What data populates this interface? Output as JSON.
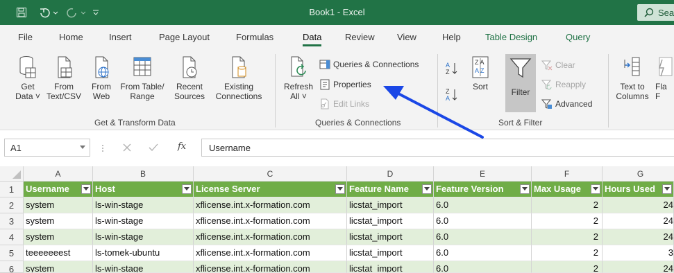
{
  "window": {
    "title": "Book1 - Excel",
    "search": "Sea"
  },
  "tabs": [
    {
      "label": "File"
    },
    {
      "label": "Home"
    },
    {
      "label": "Insert"
    },
    {
      "label": "Page Layout"
    },
    {
      "label": "Formulas"
    },
    {
      "label": "Data"
    },
    {
      "label": "Review"
    },
    {
      "label": "View"
    },
    {
      "label": "Help"
    },
    {
      "label": "Table Design"
    },
    {
      "label": "Query"
    }
  ],
  "ribbon": {
    "get_data": {
      "line1": "Get",
      "line2": "Data ˅"
    },
    "from_text": {
      "line1": "From",
      "line2": "Text/CSV"
    },
    "from_web": {
      "line1": "From",
      "line2": "Web"
    },
    "from_table": {
      "line1": "From Table/",
      "line2": "Range"
    },
    "recent": {
      "line1": "Recent",
      "line2": "Sources"
    },
    "existing": {
      "line1": "Existing",
      "line2": "Connections"
    },
    "group_get": "Get & Transform Data",
    "refresh": {
      "line1": "Refresh",
      "line2": "All ˅"
    },
    "queries_connections": "Queries & Connections",
    "properties": "Properties",
    "edit_links": "Edit Links",
    "group_queries": "Queries & Connections",
    "sort": "Sort",
    "filter": "Filter",
    "clear": "Clear",
    "reapply": "Reapply",
    "advanced": "Advanced",
    "group_sort": "Sort & Filter",
    "text_to_columns": {
      "line1": "Text to",
      "line2": "Columns"
    },
    "flash": {
      "line1": "Fla",
      "line2": "F"
    }
  },
  "formula_bar": {
    "name_box": "A1",
    "fx": "fx",
    "value": "Username"
  },
  "sheet": {
    "columns": [
      "A",
      "B",
      "C",
      "D",
      "E",
      "F",
      "G"
    ],
    "headers": [
      "Username",
      "Host",
      "License Server",
      "Feature Name",
      "Feature Version",
      "Max Usage",
      "Hours Used"
    ],
    "rows": [
      {
        "n": "2",
        "cells": [
          "system",
          "ls-win-stage",
          "xflicense.int.x-formation.com",
          "licstat_import",
          "6.0",
          "2",
          "24"
        ]
      },
      {
        "n": "3",
        "cells": [
          "system",
          "ls-win-stage",
          "xflicense.int.x-formation.com",
          "licstat_import",
          "6.0",
          "2",
          "24"
        ]
      },
      {
        "n": "4",
        "cells": [
          "system",
          "ls-win-stage",
          "xflicense.int.x-formation.com",
          "licstat_import",
          "6.0",
          "2",
          "24"
        ]
      },
      {
        "n": "5",
        "cells": [
          "teeeeeeest",
          "ls-tomek-ubuntu",
          "xflicense.int.x-formation.com",
          "licstat_import",
          "6.0",
          "2",
          "3"
        ]
      },
      {
        "n": "6",
        "cells": [
          "system",
          "ls-win-stage",
          "xflicense.int.x-formation.com",
          "licstat_import",
          "6.0",
          "2",
          "24"
        ]
      }
    ],
    "header_row_number": "1"
  },
  "colors": {
    "brand": "#217346",
    "table_header": "#70ad47",
    "band": "#e2efda",
    "arrow": "#1a47e6"
  }
}
